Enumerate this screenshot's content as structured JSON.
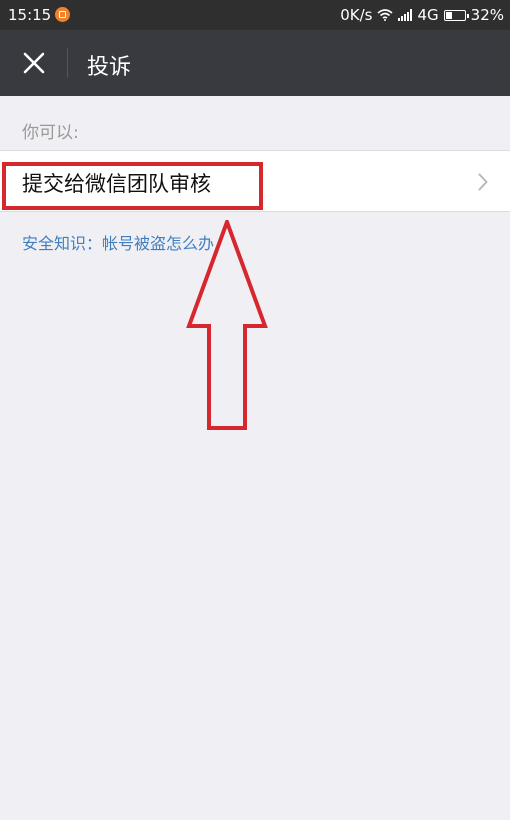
{
  "status_bar": {
    "time": "15:15",
    "network_speed": "0K/s",
    "network_type": "4G",
    "battery": "32%"
  },
  "nav": {
    "title": "投诉",
    "close_icon": "close-icon"
  },
  "content": {
    "hint": "你可以:",
    "option_label": "提交给微信团队审核",
    "safety_link": "安全知识：帐号被盗怎么办"
  },
  "annotation": {
    "color": "#d7272e",
    "arrow": "up-arrow-icon"
  },
  "colors": {
    "nav_background": "#393a3f",
    "page_background": "#efeff4",
    "link": "#3f7fbf"
  }
}
